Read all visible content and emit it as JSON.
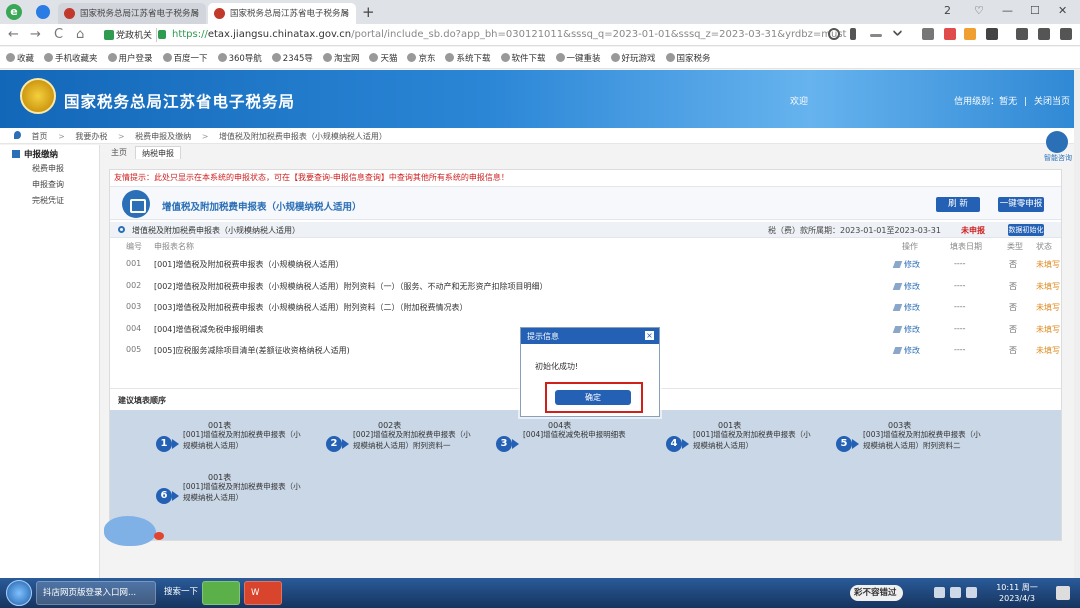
{
  "browser": {
    "tabs": [
      {
        "title": "国家税务总局江苏省电子税务局",
        "active": false
      },
      {
        "title": "国家税务总局江苏省电子税务局",
        "active": true
      }
    ],
    "new_tab": "+",
    "tab_close": "×",
    "site_badge": "党政机关",
    "url_scheme": "https://",
    "url_host": "etax.jiangsu.chinatax.gov.cn",
    "url_rest": "/portal/include_sb.do?app_bh=030121011&sssq_q=2023-01-01&sssq_z=2023-03-31&yrdbz=must",
    "nav": {
      "back": "←",
      "forward": "→",
      "reload": "C",
      "home": "⌂"
    },
    "window_controls": {
      "min": "—",
      "max": "☐",
      "close": "✕",
      "num": "2"
    }
  },
  "bookmarks": [
    "收藏",
    "手机收藏夹",
    "用户登录",
    "百度一下",
    "360导航",
    "2345导",
    "淘宝网",
    "天猫",
    "京东",
    "系统下载",
    "软件下载",
    "一键重装",
    "好玩游戏",
    "国家税务"
  ],
  "header": {
    "site_title": "国家税务总局江苏省电子税务局",
    "welcome": "欢迎",
    "credit_label": "信用级别：暂无",
    "sep": "|",
    "close_page": "关闭当页"
  },
  "breadcrumb": {
    "items": [
      "首页",
      "我要办税",
      "税费申报及缴纳",
      "增值税及附加税费申报表（小规模纳税人适用）"
    ],
    "sep": ">"
  },
  "sidebar": {
    "title": "申报缴纳",
    "items": [
      "税费申报",
      "申报查询",
      "完税凭证"
    ]
  },
  "subtabs": {
    "home": "主页",
    "active": "纳税申报"
  },
  "help_label": "智能咨询",
  "panel": {
    "tip": "友情提示：此处只显示在本系统的申报状态，可在【我要查询-申报信息查询】中查询其他所有系统的申报信息！",
    "form_title": "增值税及附加税费申报表（小规模纳税人适用）",
    "btn_refresh": "刷 新",
    "btn_zero": "一键零申报",
    "status_title": "增值税及附加税费申报表（小规模纳税人适用）",
    "period": "税（费）款所属期：2023-01-01至2023-03-31",
    "undeclared": "未申报",
    "btn_reinit": "数据初始化",
    "columns": {
      "num": "编号",
      "name": "申报表名称",
      "action": "操作",
      "date": "填表日期",
      "mark": "类型",
      "state": "状态"
    },
    "rows": [
      {
        "num": "001",
        "name": "[001]增值税及附加税费申报表（小规模纳税人适用）",
        "action": "修改",
        "date": "----",
        "mark": "否",
        "state": "未填写"
      },
      {
        "num": "002",
        "name": "[002]增值税及附加税费申报表（小规模纳税人适用）附列资料（一）（服务、不动产和无形资产扣除项目明细）",
        "action": "修改",
        "date": "----",
        "mark": "否",
        "state": "未填写"
      },
      {
        "num": "003",
        "name": "[003]增值税及附加税费申报表（小规模纳税人适用）附列资料（二）（附加税费情况表）",
        "action": "修改",
        "date": "----",
        "mark": "否",
        "state": "未填写"
      },
      {
        "num": "004",
        "name": "[004]增值税减免税申报明细表",
        "action": "修改",
        "date": "----",
        "mark": "否",
        "state": "未填写"
      },
      {
        "num": "005",
        "name": "[005]应税服务减除项目清单(差额征收资格纳税人适用)",
        "action": "修改",
        "date": "----",
        "mark": "否",
        "state": "未填写"
      }
    ],
    "order_title": "建议填表顺序",
    "steps": [
      {
        "n": "1",
        "code": "001表",
        "desc": "[001]增值税及附加税费申报表（小规模纳税人适用）"
      },
      {
        "n": "2",
        "code": "002表",
        "desc": "[002]增值税及附加税费申报表（小规模纳税人适用）附列资料一"
      },
      {
        "n": "3",
        "code": "004表",
        "desc": "[004]增值税减免税申报明细表"
      },
      {
        "n": "4",
        "code": "001表",
        "desc": "[001]增值税及附加税费申报表（小规模纳税人适用）"
      },
      {
        "n": "5",
        "code": "003表",
        "desc": "[003]增值税及附加税费申报表（小规模纳税人适用）附列资料二"
      },
      {
        "n": "6",
        "code": "001表",
        "desc": "[001]增值税及附加税费申报表（小规模纳税人适用）"
      }
    ]
  },
  "modal": {
    "title": "提示信息",
    "close": "×",
    "message": "初始化成功!",
    "ok": "确定"
  },
  "taskbar": {
    "ie_task": "抖店网页版登录入口网...",
    "search": "搜索一下",
    "app1": "",
    "app2": "W",
    "input_tray": "彩不容错过",
    "time": "10:11 周一",
    "date": "2023/4/3"
  }
}
